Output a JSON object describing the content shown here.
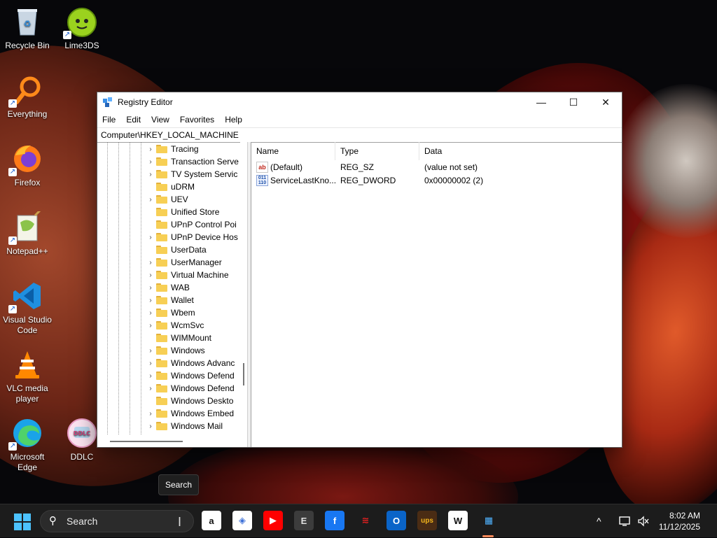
{
  "desktop": {
    "icons": [
      {
        "label": "Recycle Bin",
        "icon": "recycle-bin-icon"
      },
      {
        "label": "Lime3DS",
        "icon": "lime3ds-icon"
      },
      {
        "label": "Everything",
        "icon": "everything-search-icon"
      },
      {
        "label": "Firefox",
        "icon": "firefox-icon"
      },
      {
        "label": "Notepad++",
        "icon": "notepad-plus-plus-icon"
      },
      {
        "label": "Visual Studio Code",
        "icon": "vscode-icon"
      },
      {
        "label": "VLC media player",
        "icon": "vlc-icon"
      },
      {
        "label": "Microsoft Edge",
        "icon": "edge-icon"
      },
      {
        "label": "DDLC",
        "icon": "ddlc-icon"
      }
    ]
  },
  "window": {
    "title": "Registry Editor",
    "controls": {
      "minimize": "—",
      "maximize": "☐",
      "close": "✕"
    },
    "menu": [
      "File",
      "Edit",
      "View",
      "Favorites",
      "Help"
    ],
    "address": "Computer\\HKEY_LOCAL_MACHINE",
    "tree": [
      {
        "label": "Tracing",
        "expandable": true
      },
      {
        "label": "Transaction Serve",
        "expandable": true
      },
      {
        "label": "TV System Servic",
        "expandable": true
      },
      {
        "label": "uDRM",
        "expandable": false
      },
      {
        "label": "UEV",
        "expandable": true
      },
      {
        "label": "Unified Store",
        "expandable": false
      },
      {
        "label": "UPnP Control Poi",
        "expandable": false
      },
      {
        "label": "UPnP Device Hos",
        "expandable": true
      },
      {
        "label": "UserData",
        "expandable": false
      },
      {
        "label": "UserManager",
        "expandable": true
      },
      {
        "label": "Virtual Machine",
        "expandable": true
      },
      {
        "label": "WAB",
        "expandable": true
      },
      {
        "label": "Wallet",
        "expandable": true
      },
      {
        "label": "Wbem",
        "expandable": true
      },
      {
        "label": "WcmSvc",
        "expandable": true
      },
      {
        "label": "WIMMount",
        "expandable": false
      },
      {
        "label": "Windows",
        "expandable": true
      },
      {
        "label": "Windows Advanc",
        "expandable": true
      },
      {
        "label": "Windows Defend",
        "expandable": true
      },
      {
        "label": "Windows Defend",
        "expandable": true
      },
      {
        "label": "Windows Deskto",
        "expandable": false
      },
      {
        "label": "Windows Embed",
        "expandable": true
      },
      {
        "label": "Windows Mail",
        "expandable": true
      }
    ],
    "columns": {
      "name": "Name",
      "type": "Type",
      "data": "Data"
    },
    "values": [
      {
        "name": "(Default)",
        "type": "REG_SZ",
        "data": "(value not set)",
        "icon": "ab"
      },
      {
        "name": "ServiceLastKno...",
        "type": "REG_DWORD",
        "data": "0x00000002 (2)",
        "icon": "011\n110"
      }
    ]
  },
  "tooltip": "Search",
  "taskbar": {
    "search_placeholder": "Search",
    "apps": [
      {
        "name": "amazon-icon",
        "glyph": "a",
        "bg": "#ffffff",
        "fg": "#111111"
      },
      {
        "name": "copilot-icon",
        "glyph": "◈",
        "bg": "#ffffff",
        "fg": "#3b6fd8"
      },
      {
        "name": "youtube-icon",
        "glyph": "▶",
        "bg": "#ff0000",
        "fg": "#ffffff"
      },
      {
        "name": "epic-games-icon",
        "glyph": "E",
        "bg": "#3c3c3c",
        "fg": "#e0e0e0"
      },
      {
        "name": "facebook-icon",
        "glyph": "f",
        "bg": "#1877f2",
        "fg": "#ffffff"
      },
      {
        "name": "app-red-stripes-icon",
        "glyph": "≋",
        "bg": "#1c1c1c",
        "fg": "#e02020"
      },
      {
        "name": "outlook-icon",
        "glyph": "O",
        "bg": "#0a64c8",
        "fg": "#ffffff"
      },
      {
        "name": "ups-icon",
        "glyph": "ups",
        "bg": "#4a2c14",
        "fg": "#f2b51c"
      },
      {
        "name": "wikipedia-icon",
        "glyph": "W",
        "bg": "#ffffff",
        "fg": "#111111"
      },
      {
        "name": "registry-editor-icon",
        "glyph": "▦",
        "bg": "#1c1c1c",
        "fg": "#4fb3ff"
      }
    ],
    "tray": {
      "overflow": "^"
    },
    "clock": {
      "time": "8:02 AM",
      "date": "11/12/2025"
    }
  }
}
